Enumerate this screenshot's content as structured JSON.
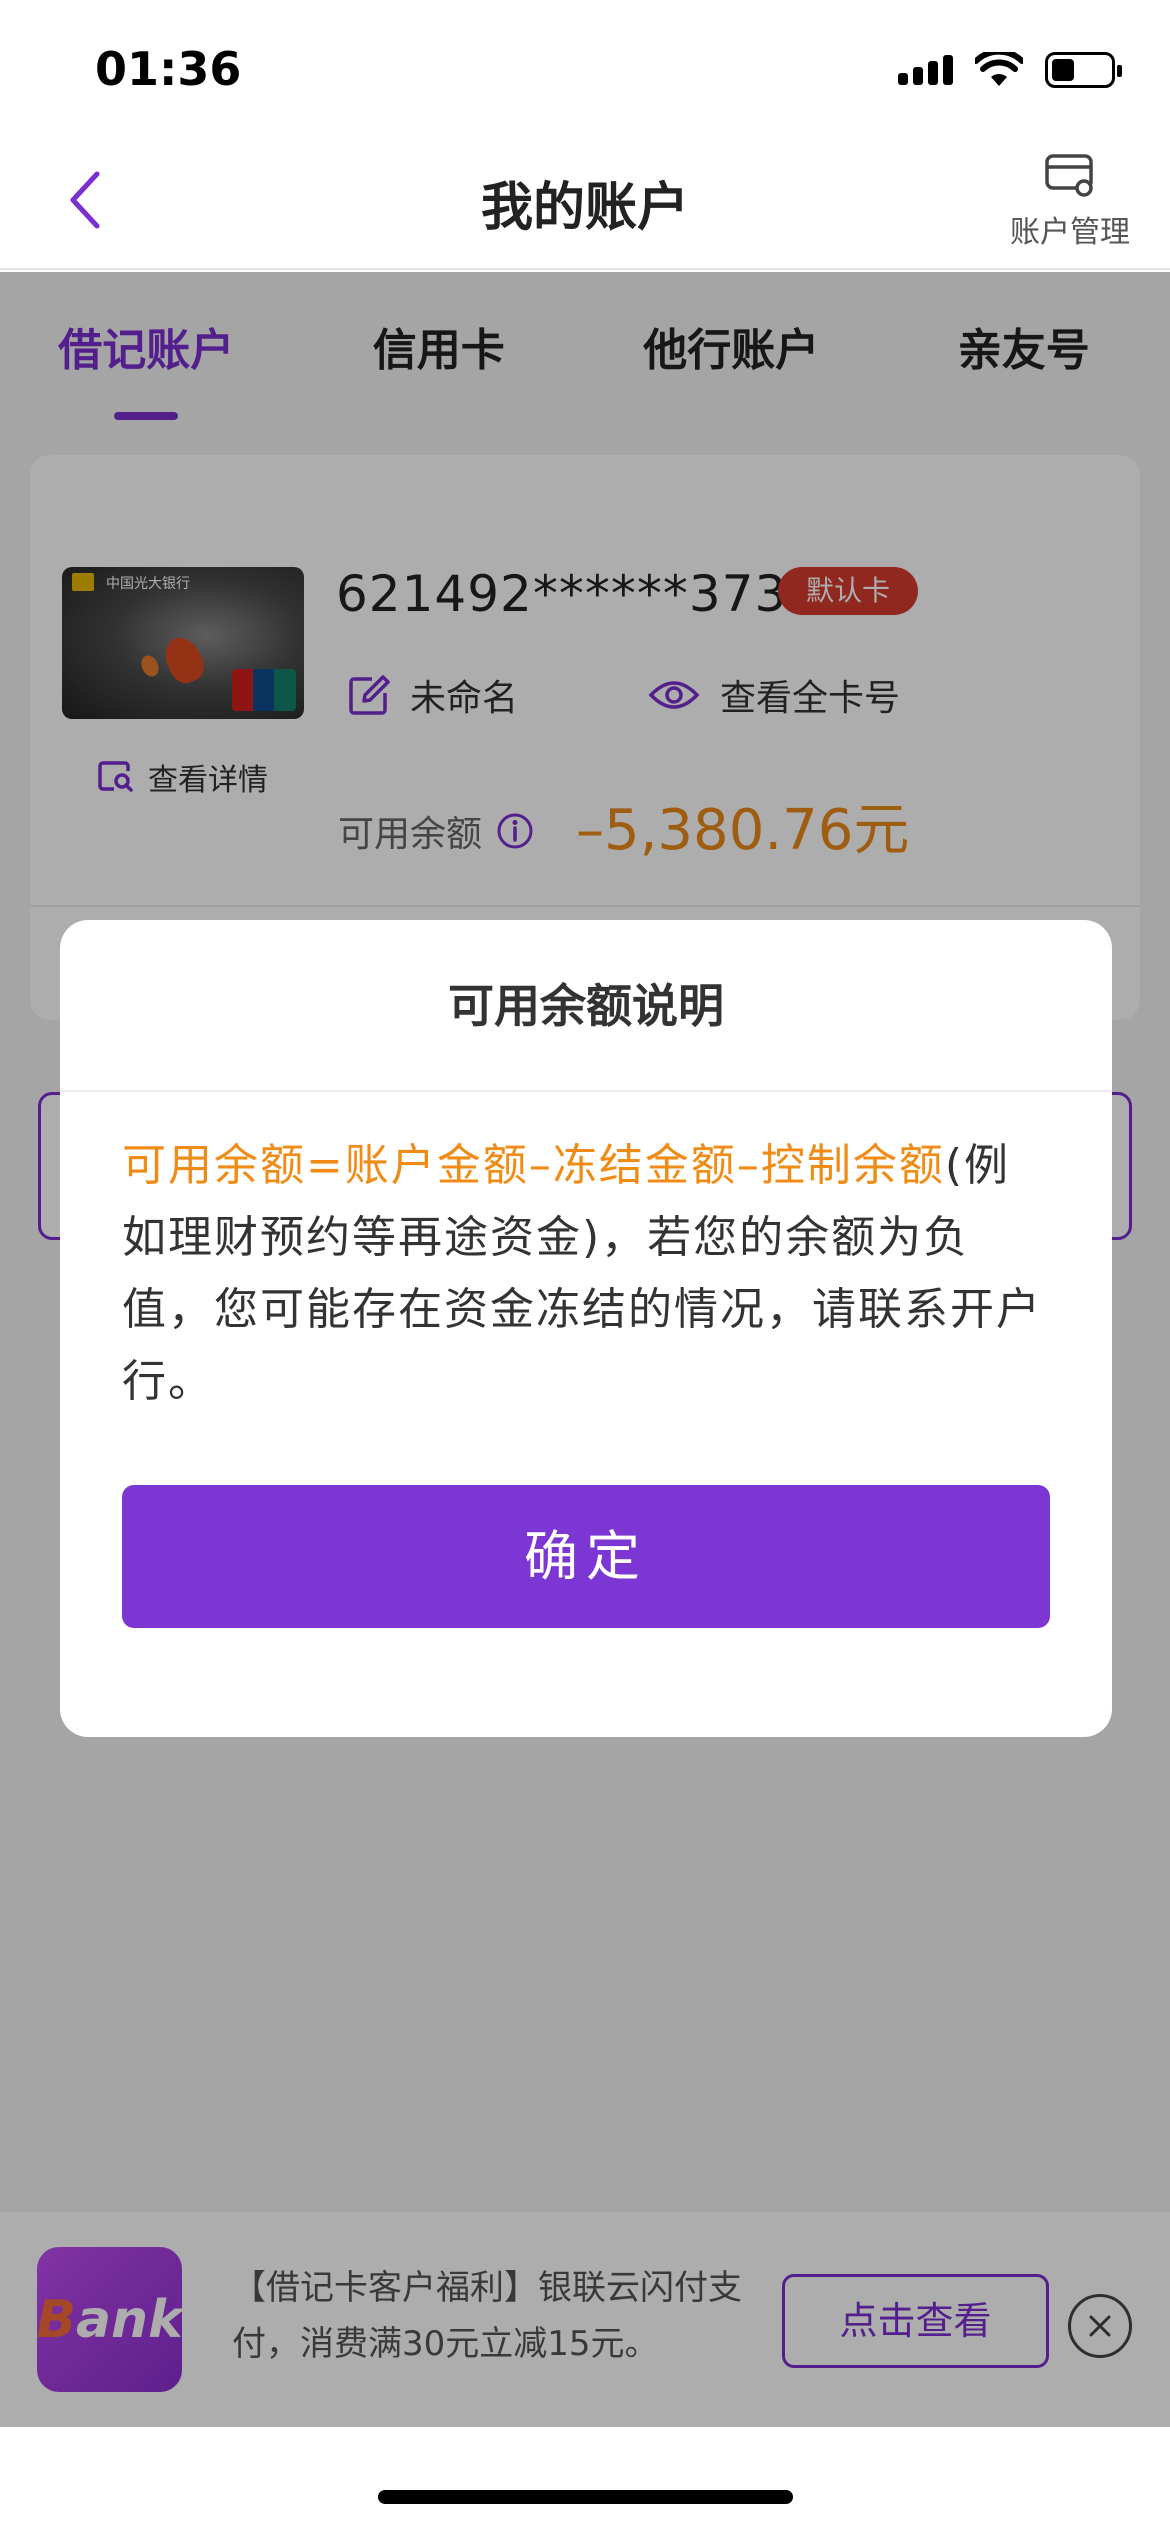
{
  "status_bar": {
    "time": "01:36"
  },
  "header": {
    "title": "我的账户",
    "account_management_label": "账户管理"
  },
  "tabs": [
    {
      "label": "借记账户",
      "active": true
    },
    {
      "label": "信用卡",
      "active": false
    },
    {
      "label": "他行账户",
      "active": false
    },
    {
      "label": "亲友号",
      "active": false
    }
  ],
  "card": {
    "bank_name": "中国光大银行",
    "number": "621492******3739",
    "default_badge": "默认卡",
    "rename_label": "未命名",
    "show_full_label": "查看全卡号",
    "view_detail_label": "查看详情",
    "balance_label": "可用余额",
    "balance_value": "–5,380.76元"
  },
  "modal": {
    "title": "可用余额说明",
    "highlight": "可用余额=账户金额–冻结金额–控制余额",
    "body": "(例如理财预约等再途资金)，若您的余额为负值，您可能存在资金冻结的情况，请联系开户行。",
    "confirm_label": "确定"
  },
  "banner": {
    "logo_text_b": "B",
    "logo_text_rest": "ank",
    "text": "【借记卡客户福利】银联云闪付支付，消费满30元立减15元。",
    "button_label": "点击查看"
  },
  "colors": {
    "accent": "#7b2fd0",
    "balance": "#e9891a",
    "highlight": "#f08c16",
    "badge": "#d63b2f"
  }
}
